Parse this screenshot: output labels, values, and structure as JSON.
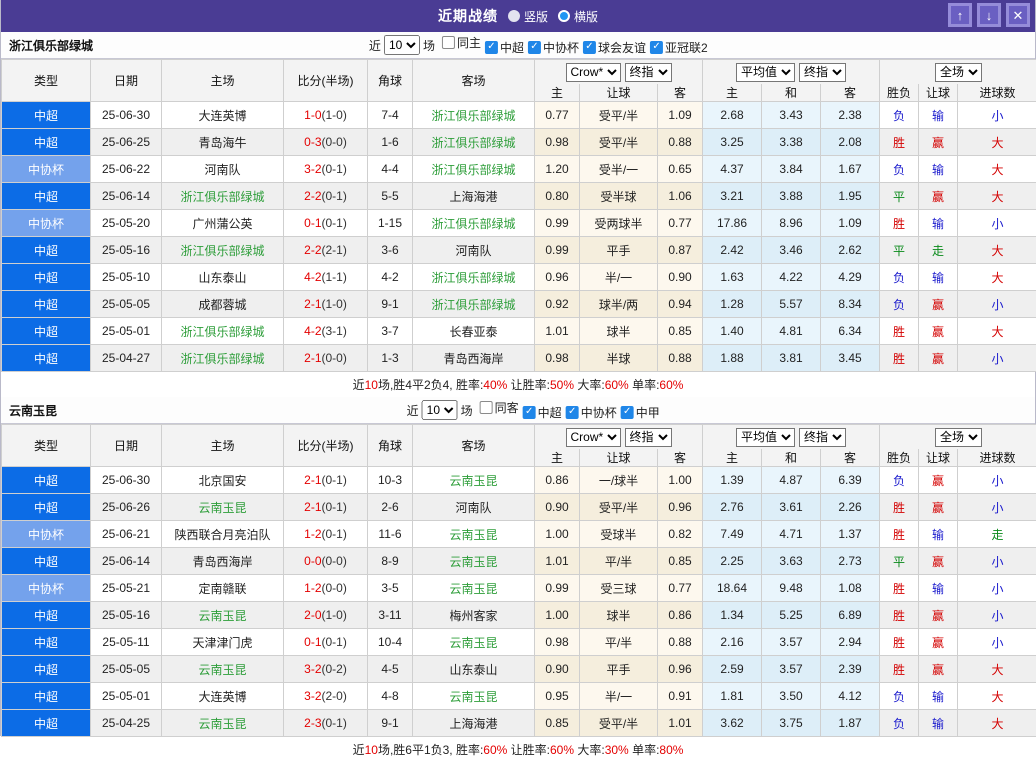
{
  "colors": {
    "titlebar_purple": "#4a3c94",
    "type_primary_blue": "#0c6ce6",
    "type_secondary_blue": "#74a2ec",
    "focus_team_green": "#2e9e3a",
    "score_red": "#e40000",
    "win_red": "#d40000",
    "lose_blue": "#1a1acd",
    "draw_green": "#0a8a1a"
  },
  "title_bar": {
    "title": "近期战绩",
    "view_options": [
      {
        "label": "竖版",
        "selected": false
      },
      {
        "label": "横版",
        "selected": true
      }
    ],
    "up_button": "↑",
    "down_button": "↓",
    "close_button": "✕"
  },
  "table_header": {
    "columns": {
      "type": "类型",
      "date": "日期",
      "home": "主场",
      "score": "比分(半场)",
      "corner": "角球",
      "away": "客场",
      "odds_home": "主",
      "odds_line": "让球",
      "odds_away": "客",
      "avg_home": "主",
      "avg_draw": "和",
      "avg_away": "客",
      "wdl": "胜负",
      "handicap": "让球",
      "goals": "进球数"
    },
    "dropdowns": {
      "odds_source": "Crow*",
      "odds_time": "终指",
      "avg_source": "平均值",
      "avg_time": "终指",
      "scope": "全场"
    }
  },
  "sections": [
    {
      "team": "浙江俱乐部绿城",
      "filter": {
        "prefix": "近",
        "count": "10",
        "suffix": "场",
        "checkboxes": [
          {
            "label": "同主",
            "checked": false
          },
          {
            "label": "中超",
            "checked": true
          },
          {
            "label": "中协杯",
            "checked": true
          },
          {
            "label": "球会友谊",
            "checked": true
          },
          {
            "label": "亚冠联2",
            "checked": true
          }
        ]
      },
      "rows": [
        {
          "type": "中超",
          "type_style": "primary",
          "date": "25-06-30",
          "home": "大连英博",
          "home_focus": false,
          "score": "1-0",
          "half": "(1-0)",
          "corner": "7-4",
          "away": "浙江俱乐部绿城",
          "away_focus": true,
          "odds": [
            "0.77",
            "受平/半",
            "1.09"
          ],
          "avg": [
            "2.68",
            "3.43",
            "2.38"
          ],
          "result_wdl": {
            "text": "负",
            "color": "blue"
          },
          "result_handicap": {
            "text": "输",
            "color": "blue"
          },
          "result_goals": {
            "text": "小",
            "color": "blue"
          }
        },
        {
          "type": "中超",
          "type_style": "primary",
          "date": "25-06-25",
          "home": "青岛海牛",
          "home_focus": false,
          "score": "0-3",
          "half": "(0-0)",
          "corner": "1-6",
          "away": "浙江俱乐部绿城",
          "away_focus": true,
          "odds": [
            "0.98",
            "受平/半",
            "0.88"
          ],
          "avg": [
            "3.25",
            "3.38",
            "2.08"
          ],
          "result_wdl": {
            "text": "胜",
            "color": "red"
          },
          "result_handicap": {
            "text": "赢",
            "color": "red"
          },
          "result_goals": {
            "text": "大",
            "color": "red"
          }
        },
        {
          "type": "中协杯",
          "type_style": "light",
          "date": "25-06-22",
          "home": "河南队",
          "home_focus": false,
          "score": "3-2",
          "half": "(0-1)",
          "corner": "4-4",
          "away": "浙江俱乐部绿城",
          "away_focus": true,
          "odds": [
            "1.20",
            "受半/一",
            "0.65"
          ],
          "avg": [
            "4.37",
            "3.84",
            "1.67"
          ],
          "result_wdl": {
            "text": "负",
            "color": "blue"
          },
          "result_handicap": {
            "text": "输",
            "color": "blue"
          },
          "result_goals": {
            "text": "大",
            "color": "red"
          }
        },
        {
          "type": "中超",
          "type_style": "primary",
          "date": "25-06-14",
          "home": "浙江俱乐部绿城",
          "home_focus": true,
          "score": "2-2",
          "half": "(0-1)",
          "corner": "5-5",
          "away": "上海海港",
          "away_focus": false,
          "odds": [
            "0.80",
            "受半球",
            "1.06"
          ],
          "avg": [
            "3.21",
            "3.88",
            "1.95"
          ],
          "result_wdl": {
            "text": "平",
            "color": "green"
          },
          "result_handicap": {
            "text": "赢",
            "color": "red"
          },
          "result_goals": {
            "text": "大",
            "color": "red"
          }
        },
        {
          "type": "中协杯",
          "type_style": "light",
          "date": "25-05-20",
          "home": "广州蒲公英",
          "home_focus": false,
          "score": "0-1",
          "half": "(0-1)",
          "corner": "1-15",
          "away": "浙江俱乐部绿城",
          "away_focus": true,
          "odds": [
            "0.99",
            "受两球半",
            "0.77"
          ],
          "avg": [
            "17.86",
            "8.96",
            "1.09"
          ],
          "result_wdl": {
            "text": "胜",
            "color": "red"
          },
          "result_handicap": {
            "text": "输",
            "color": "blue"
          },
          "result_goals": {
            "text": "小",
            "color": "blue"
          }
        },
        {
          "type": "中超",
          "type_style": "primary",
          "date": "25-05-16",
          "home": "浙江俱乐部绿城",
          "home_focus": true,
          "score": "2-2",
          "half": "(2-1)",
          "corner": "3-6",
          "away": "河南队",
          "away_focus": false,
          "odds": [
            "0.99",
            "平手",
            "0.87"
          ],
          "avg": [
            "2.42",
            "3.46",
            "2.62"
          ],
          "result_wdl": {
            "text": "平",
            "color": "green"
          },
          "result_handicap": {
            "text": "走",
            "color": "green"
          },
          "result_goals": {
            "text": "大",
            "color": "red"
          }
        },
        {
          "type": "中超",
          "type_style": "primary",
          "date": "25-05-10",
          "home": "山东泰山",
          "home_focus": false,
          "score": "4-2",
          "half": "(1-1)",
          "corner": "4-2",
          "away": "浙江俱乐部绿城",
          "away_focus": true,
          "odds": [
            "0.96",
            "半/一",
            "0.90"
          ],
          "avg": [
            "1.63",
            "4.22",
            "4.29"
          ],
          "result_wdl": {
            "text": "负",
            "color": "blue"
          },
          "result_handicap": {
            "text": "输",
            "color": "blue"
          },
          "result_goals": {
            "text": "大",
            "color": "red"
          }
        },
        {
          "type": "中超",
          "type_style": "primary",
          "date": "25-05-05",
          "home": "成都蓉城",
          "home_focus": false,
          "score": "2-1",
          "half": "(1-0)",
          "corner": "9-1",
          "away": "浙江俱乐部绿城",
          "away_focus": true,
          "odds": [
            "0.92",
            "球半/两",
            "0.94"
          ],
          "avg": [
            "1.28",
            "5.57",
            "8.34"
          ],
          "result_wdl": {
            "text": "负",
            "color": "blue"
          },
          "result_handicap": {
            "text": "赢",
            "color": "red"
          },
          "result_goals": {
            "text": "小",
            "color": "blue"
          }
        },
        {
          "type": "中超",
          "type_style": "primary",
          "date": "25-05-01",
          "home": "浙江俱乐部绿城",
          "home_focus": true,
          "score": "4-2",
          "half": "(3-1)",
          "corner": "3-7",
          "away": "长春亚泰",
          "away_focus": false,
          "odds": [
            "1.01",
            "球半",
            "0.85"
          ],
          "avg": [
            "1.40",
            "4.81",
            "6.34"
          ],
          "result_wdl": {
            "text": "胜",
            "color": "red"
          },
          "result_handicap": {
            "text": "赢",
            "color": "red"
          },
          "result_goals": {
            "text": "大",
            "color": "red"
          }
        },
        {
          "type": "中超",
          "type_style": "primary",
          "date": "25-04-27",
          "home": "浙江俱乐部绿城",
          "home_focus": true,
          "score": "2-1",
          "half": "(0-0)",
          "corner": "1-3",
          "away": "青岛西海岸",
          "away_focus": false,
          "odds": [
            "0.98",
            "半球",
            "0.88"
          ],
          "avg": [
            "1.88",
            "3.81",
            "3.45"
          ],
          "result_wdl": {
            "text": "胜",
            "color": "red"
          },
          "result_handicap": {
            "text": "赢",
            "color": "red"
          },
          "result_goals": {
            "text": "小",
            "color": "blue"
          }
        }
      ],
      "summary": [
        {
          "text": "近",
          "red": false
        },
        {
          "text": "10",
          "red": true
        },
        {
          "text": "场,胜4平2负4, 胜率:",
          "red": false
        },
        {
          "text": "40%",
          "red": true
        },
        {
          "text": " 让胜率:",
          "red": false
        },
        {
          "text": "50%",
          "red": true
        },
        {
          "text": " 大率:",
          "red": false
        },
        {
          "text": "60%",
          "red": true
        },
        {
          "text": " 单率:",
          "red": false
        },
        {
          "text": "60%",
          "red": true
        }
      ]
    },
    {
      "team": "云南玉昆",
      "filter": {
        "prefix": "近",
        "count": "10",
        "suffix": "场",
        "checkboxes": [
          {
            "label": "同客",
            "checked": false
          },
          {
            "label": "中超",
            "checked": true
          },
          {
            "label": "中协杯",
            "checked": true
          },
          {
            "label": "中甲",
            "checked": true
          }
        ]
      },
      "rows": [
        {
          "type": "中超",
          "type_style": "primary",
          "date": "25-06-30",
          "home": "北京国安",
          "home_focus": false,
          "score": "2-1",
          "half": "(0-1)",
          "corner": "10-3",
          "away": "云南玉昆",
          "away_focus": true,
          "odds": [
            "0.86",
            "一/球半",
            "1.00"
          ],
          "avg": [
            "1.39",
            "4.87",
            "6.39"
          ],
          "result_wdl": {
            "text": "负",
            "color": "blue"
          },
          "result_handicap": {
            "text": "赢",
            "color": "red"
          },
          "result_goals": {
            "text": "小",
            "color": "blue"
          }
        },
        {
          "type": "中超",
          "type_style": "primary",
          "date": "25-06-26",
          "home": "云南玉昆",
          "home_focus": true,
          "score": "2-1",
          "half": "(0-1)",
          "corner": "2-6",
          "away": "河南队",
          "away_focus": false,
          "odds": [
            "0.90",
            "受平/半",
            "0.96"
          ],
          "avg": [
            "2.76",
            "3.61",
            "2.26"
          ],
          "result_wdl": {
            "text": "胜",
            "color": "red"
          },
          "result_handicap": {
            "text": "赢",
            "color": "red"
          },
          "result_goals": {
            "text": "小",
            "color": "blue"
          }
        },
        {
          "type": "中协杯",
          "type_style": "light",
          "date": "25-06-21",
          "home": "陕西联合月亮泊队",
          "home_focus": false,
          "score": "1-2",
          "half": "(0-1)",
          "corner": "11-6",
          "away": "云南玉昆",
          "away_focus": true,
          "odds": [
            "1.00",
            "受球半",
            "0.82"
          ],
          "avg": [
            "7.49",
            "4.71",
            "1.37"
          ],
          "result_wdl": {
            "text": "胜",
            "color": "red"
          },
          "result_handicap": {
            "text": "输",
            "color": "blue"
          },
          "result_goals": {
            "text": "走",
            "color": "green"
          }
        },
        {
          "type": "中超",
          "type_style": "primary",
          "date": "25-06-14",
          "home": "青岛西海岸",
          "home_focus": false,
          "score": "0-0",
          "half": "(0-0)",
          "corner": "8-9",
          "away": "云南玉昆",
          "away_focus": true,
          "odds": [
            "1.01",
            "平/半",
            "0.85"
          ],
          "avg": [
            "2.25",
            "3.63",
            "2.73"
          ],
          "result_wdl": {
            "text": "平",
            "color": "green"
          },
          "result_handicap": {
            "text": "赢",
            "color": "red"
          },
          "result_goals": {
            "text": "小",
            "color": "blue"
          }
        },
        {
          "type": "中协杯",
          "type_style": "light",
          "date": "25-05-21",
          "home": "定南赣联",
          "home_focus": false,
          "score": "1-2",
          "half": "(0-0)",
          "corner": "3-5",
          "away": "云南玉昆",
          "away_focus": true,
          "odds": [
            "0.99",
            "受三球",
            "0.77"
          ],
          "avg": [
            "18.64",
            "9.48",
            "1.08"
          ],
          "result_wdl": {
            "text": "胜",
            "color": "red"
          },
          "result_handicap": {
            "text": "输",
            "color": "blue"
          },
          "result_goals": {
            "text": "小",
            "color": "blue"
          }
        },
        {
          "type": "中超",
          "type_style": "primary",
          "date": "25-05-16",
          "home": "云南玉昆",
          "home_focus": true,
          "score": "2-0",
          "half": "(1-0)",
          "corner": "3-11",
          "away": "梅州客家",
          "away_focus": false,
          "odds": [
            "1.00",
            "球半",
            "0.86"
          ],
          "avg": [
            "1.34",
            "5.25",
            "6.89"
          ],
          "result_wdl": {
            "text": "胜",
            "color": "red"
          },
          "result_handicap": {
            "text": "赢",
            "color": "red"
          },
          "result_goals": {
            "text": "小",
            "color": "blue"
          }
        },
        {
          "type": "中超",
          "type_style": "primary",
          "date": "25-05-11",
          "home": "天津津门虎",
          "home_focus": false,
          "score": "0-1",
          "half": "(0-1)",
          "corner": "10-4",
          "away": "云南玉昆",
          "away_focus": true,
          "odds": [
            "0.98",
            "平/半",
            "0.88"
          ],
          "avg": [
            "2.16",
            "3.57",
            "2.94"
          ],
          "result_wdl": {
            "text": "胜",
            "color": "red"
          },
          "result_handicap": {
            "text": "赢",
            "color": "red"
          },
          "result_goals": {
            "text": "小",
            "color": "blue"
          }
        },
        {
          "type": "中超",
          "type_style": "primary",
          "date": "25-05-05",
          "home": "云南玉昆",
          "home_focus": true,
          "score": "3-2",
          "half": "(0-2)",
          "corner": "4-5",
          "away": "山东泰山",
          "away_focus": false,
          "odds": [
            "0.90",
            "平手",
            "0.96"
          ],
          "avg": [
            "2.59",
            "3.57",
            "2.39"
          ],
          "result_wdl": {
            "text": "胜",
            "color": "red"
          },
          "result_handicap": {
            "text": "赢",
            "color": "red"
          },
          "result_goals": {
            "text": "大",
            "color": "red"
          }
        },
        {
          "type": "中超",
          "type_style": "primary",
          "date": "25-05-01",
          "home": "大连英博",
          "home_focus": false,
          "score": "3-2",
          "half": "(2-0)",
          "corner": "4-8",
          "away": "云南玉昆",
          "away_focus": true,
          "odds": [
            "0.95",
            "半/一",
            "0.91"
          ],
          "avg": [
            "1.81",
            "3.50",
            "4.12"
          ],
          "result_wdl": {
            "text": "负",
            "color": "blue"
          },
          "result_handicap": {
            "text": "输",
            "color": "blue"
          },
          "result_goals": {
            "text": "大",
            "color": "red"
          }
        },
        {
          "type": "中超",
          "type_style": "primary",
          "date": "25-04-25",
          "home": "云南玉昆",
          "home_focus": true,
          "score": "2-3",
          "half": "(0-1)",
          "corner": "9-1",
          "away": "上海海港",
          "away_focus": false,
          "odds": [
            "0.85",
            "受平/半",
            "1.01"
          ],
          "avg": [
            "3.62",
            "3.75",
            "1.87"
          ],
          "result_wdl": {
            "text": "负",
            "color": "blue"
          },
          "result_handicap": {
            "text": "输",
            "color": "blue"
          },
          "result_goals": {
            "text": "大",
            "color": "red"
          }
        }
      ],
      "summary": [
        {
          "text": "近",
          "red": false
        },
        {
          "text": "10",
          "red": true
        },
        {
          "text": "场,胜6平1负3, 胜率:",
          "red": false
        },
        {
          "text": "60%",
          "red": true
        },
        {
          "text": " 让胜率:",
          "red": false
        },
        {
          "text": "60%",
          "red": true
        },
        {
          "text": " 大率:",
          "red": false
        },
        {
          "text": "30%",
          "red": true
        },
        {
          "text": " 单率:",
          "red": false
        },
        {
          "text": "80%",
          "red": true
        }
      ]
    }
  ]
}
